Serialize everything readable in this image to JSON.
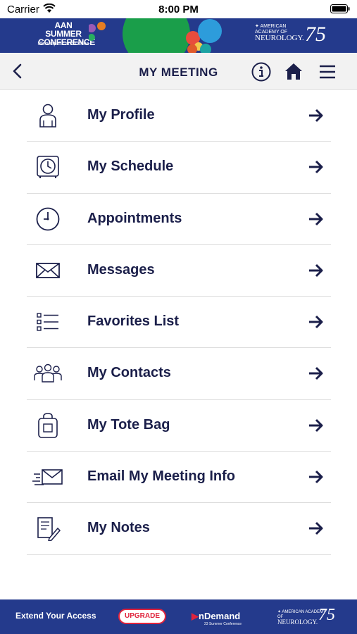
{
  "status_bar": {
    "carrier": "Carrier",
    "time": "8:00 PM"
  },
  "banner": {
    "event_title_line1": "AAN SUMMER",
    "event_title_line2": "CONFERENCE",
    "event_subtitle": "Minneapolis and Online",
    "org_line1": "AMERICAN ACADEMY OF",
    "org_line2": "NEUROLOGY.",
    "anniversary": "75"
  },
  "navbar": {
    "title": "MY MEETING",
    "back_icon": "chevron-left-icon",
    "info_icon": "info-icon",
    "home_icon": "home-icon",
    "menu_icon": "hamburger-icon"
  },
  "menu": {
    "items": [
      {
        "label": "My Profile",
        "icon": "person-icon"
      },
      {
        "label": "My Schedule",
        "icon": "clock-schedule-icon"
      },
      {
        "label": "Appointments",
        "icon": "clock-icon"
      },
      {
        "label": "Messages",
        "icon": "envelope-icon"
      },
      {
        "label": "Favorites List",
        "icon": "checklist-icon"
      },
      {
        "label": "My Contacts",
        "icon": "group-icon"
      },
      {
        "label": "My Tote Bag",
        "icon": "bag-icon"
      },
      {
        "label": "Email My Meeting Info",
        "icon": "send-mail-icon"
      },
      {
        "label": "My Notes",
        "icon": "notes-icon"
      }
    ]
  },
  "footer": {
    "extend_text": "Extend Your Access",
    "upgrade_label": "UPGRADE",
    "ondemand_label": "nDemand",
    "ondemand_sub": "23 Summer Conference",
    "org_line1": "AMERICAN ACADEMY OF",
    "org_line2": "NEUROLOGY.",
    "anniversary": "75"
  },
  "colors": {
    "brand_navy": "#243a8c",
    "text_navy": "#1b1f4a",
    "upgrade_red": "#e0233c"
  }
}
